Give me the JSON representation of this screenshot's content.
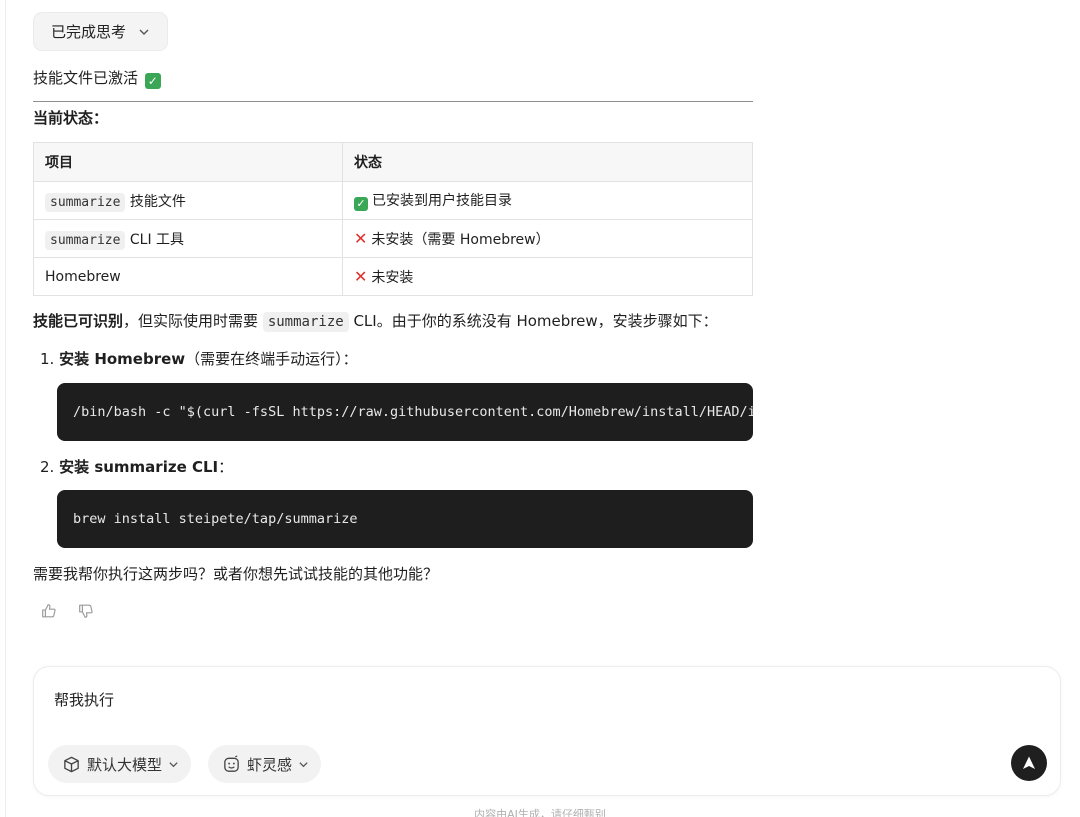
{
  "thinking": {
    "label": "已完成思考"
  },
  "message": {
    "activated": "技能文件已激活",
    "status_heading": "当前状态：",
    "table": {
      "headers": [
        "项目",
        "状态"
      ],
      "rows": [
        {
          "code": "summarize",
          "item": "技能文件",
          "status": "已安装到用户技能目录",
          "status_icon": "check"
        },
        {
          "code": "summarize",
          "item": "CLI 工具",
          "status": "未安装（需要 Homebrew）",
          "status_icon": "cross"
        },
        {
          "code": "",
          "item": "Homebrew",
          "status": "未安装",
          "status_icon": "cross"
        }
      ]
    },
    "para": {
      "bold": "技能已可识别",
      "text1": "，但实际使用时需要",
      "code": "summarize",
      "text2": "CLI。由于你的系统没有 Homebrew，安装步骤如下："
    },
    "steps": [
      {
        "num": "1.",
        "bold": "安装 Homebrew",
        "rest": "（需要在终端手动运行）：",
        "code": "/bin/bash -c \"$(curl -fsSL https://raw.githubusercontent.com/Homebrew/install/HEAD/install.sh)\""
      },
      {
        "num": "2.",
        "bold": "安装 summarize CLI",
        "rest": "：",
        "code": "brew install steipete/tap/summarize"
      }
    ],
    "closing": "需要我帮你执行这两步吗？或者你想先试试技能的其他功能？"
  },
  "feedback": {
    "like_icon": "thumbs-up-icon",
    "dislike_icon": "thumbs-down-icon"
  },
  "composer": {
    "text": "帮我执行",
    "model_label": "默认大模型",
    "mode_label": "虾灵感"
  },
  "footer": {
    "note": "内容由AI生成，请仔细甄别"
  },
  "colors": {
    "accent": "#1f1f1f",
    "check": "#3aa757",
    "cross": "#e0302b",
    "code_bg": "#1e1e1e"
  }
}
